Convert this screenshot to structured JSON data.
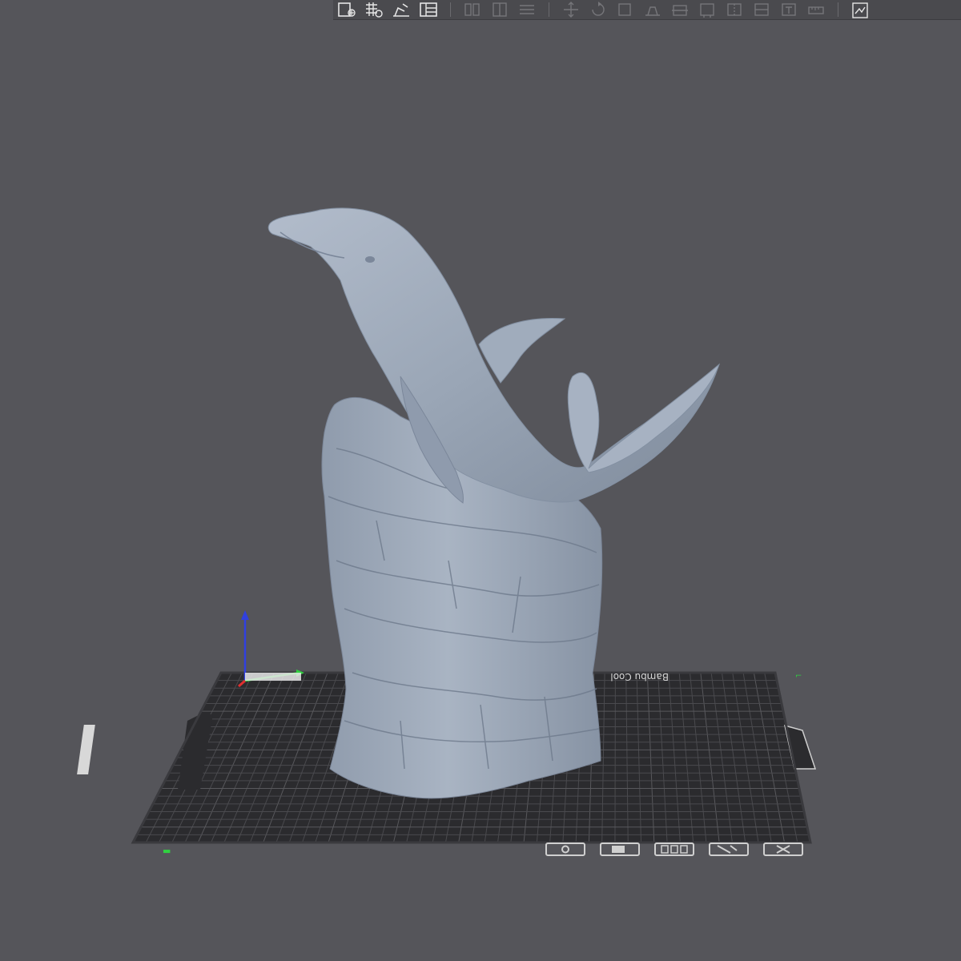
{
  "app": {
    "bed_brand_text": "Bambu Cool"
  },
  "toolbar": {
    "groups": [
      [
        {
          "name": "add-plate-icon",
          "enabled": true
        },
        {
          "name": "arrange-grid-icon",
          "enabled": true
        },
        {
          "name": "orient-icon",
          "enabled": true
        },
        {
          "name": "layout-icon",
          "enabled": true
        }
      ],
      [
        {
          "name": "split-objects-icon",
          "enabled": false
        },
        {
          "name": "split-parts-icon",
          "enabled": false
        },
        {
          "name": "layers-icon",
          "enabled": false
        }
      ],
      [
        {
          "name": "move-icon",
          "enabled": false
        },
        {
          "name": "rotate-icon",
          "enabled": false
        },
        {
          "name": "scale-icon",
          "enabled": false
        },
        {
          "name": "lay-on-face-icon",
          "enabled": false
        },
        {
          "name": "cut-icon",
          "enabled": false
        },
        {
          "name": "support-paint-icon",
          "enabled": false
        },
        {
          "name": "seam-paint-icon",
          "enabled": false
        },
        {
          "name": "color-paint-icon",
          "enabled": false
        },
        {
          "name": "emboss-icon",
          "enabled": false
        },
        {
          "name": "measure-icon",
          "enabled": false
        }
      ],
      [
        {
          "name": "assembly-view-icon",
          "enabled": true
        }
      ]
    ]
  },
  "plate_tools": [
    {
      "name": "plate-view-icon"
    },
    {
      "name": "plate-lock-icon"
    },
    {
      "name": "plate-arrange-icon"
    },
    {
      "name": "plate-settings-icon"
    },
    {
      "name": "plate-delete-icon"
    }
  ],
  "colors": {
    "background": "#55555a",
    "bed": "#2b2b2e",
    "grid": "#4a4a4e",
    "model": "#9aa6b6",
    "axis_x": "#e03030",
    "axis_y": "#30d040",
    "axis_z": "#3040e0"
  }
}
